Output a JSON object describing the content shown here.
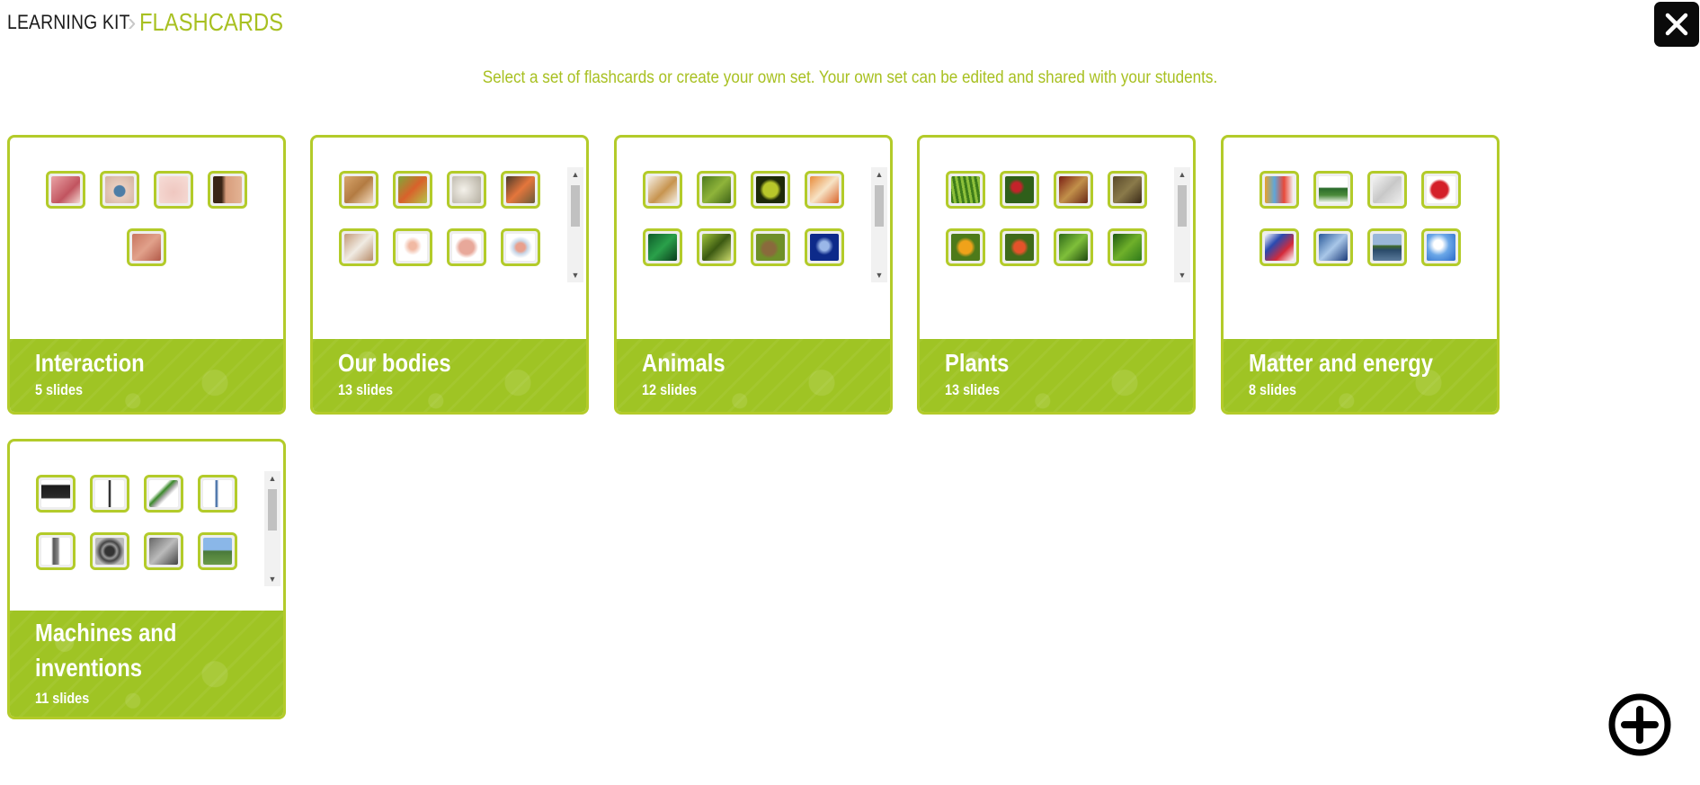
{
  "breadcrumb": {
    "root": "LEARNING KIT",
    "current": "FLASHCARDS"
  },
  "subtitle": "Select a set of flashcards or create your own set. Your own set can be edited and shared with your students.",
  "icons": {
    "close": "close-icon",
    "add": "plus-circle-icon",
    "separator": "chevron-right-icon"
  },
  "colors": {
    "accent": "#a8c021",
    "card_border": "#b3cb2a",
    "banner": "#9fc424"
  },
  "sets": [
    {
      "title": "Interaction",
      "count": "5 slides",
      "thumbs": [
        "tongue",
        "eye",
        "nose",
        "ear",
        "skin"
      ]
    },
    {
      "title": "Our bodies",
      "count": "13 slides",
      "thumbs": [
        "bread",
        "vegetables",
        "garlic",
        "salmon",
        "food",
        "body",
        "lungs",
        "organs"
      ]
    },
    {
      "title": "Animals",
      "count": "12 slides",
      "thumbs": [
        "giraffe",
        "dragonfly",
        "snake",
        "clownfish",
        "frog",
        "butterfly",
        "snail",
        "jellyfish"
      ]
    },
    {
      "title": "Plants",
      "count": "13 slides",
      "thumbs": [
        "grass",
        "roses",
        "insect",
        "roots",
        "flowers",
        "fruit",
        "moss",
        "fern"
      ]
    },
    {
      "title": "Matter and energy",
      "count": "8 slides",
      "thumbs": [
        "bottles",
        "glass bottles",
        "newspaper",
        "cans",
        "plastic",
        "ice",
        "lake",
        "sky"
      ]
    },
    {
      "title_lines": [
        "Machines and",
        "inventions"
      ],
      "count": "11 slides",
      "thumbs": [
        "computer",
        "hammer",
        "scissors",
        "hand truck",
        "phone",
        "gears",
        "engine",
        "tools"
      ]
    }
  ]
}
